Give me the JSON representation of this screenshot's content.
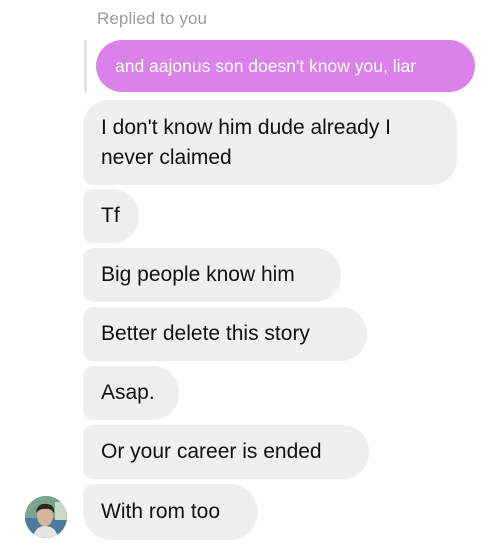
{
  "reply_context": {
    "label": "Replied to you",
    "quoted_message": "and aajonus son doesn't know you, liar"
  },
  "messages": [
    {
      "text": "I don't know him dude already I never claimed"
    },
    {
      "text": "Tf"
    },
    {
      "text": "Big people know him"
    },
    {
      "text": "Better delete this story"
    },
    {
      "text": "Asap."
    },
    {
      "text": "Or your career is ended"
    },
    {
      "text": "With rom too"
    }
  ],
  "colors": {
    "quoted_bubble": "#da81ea",
    "received_bubble": "#efefef",
    "meta_text": "#9b9b9b"
  }
}
